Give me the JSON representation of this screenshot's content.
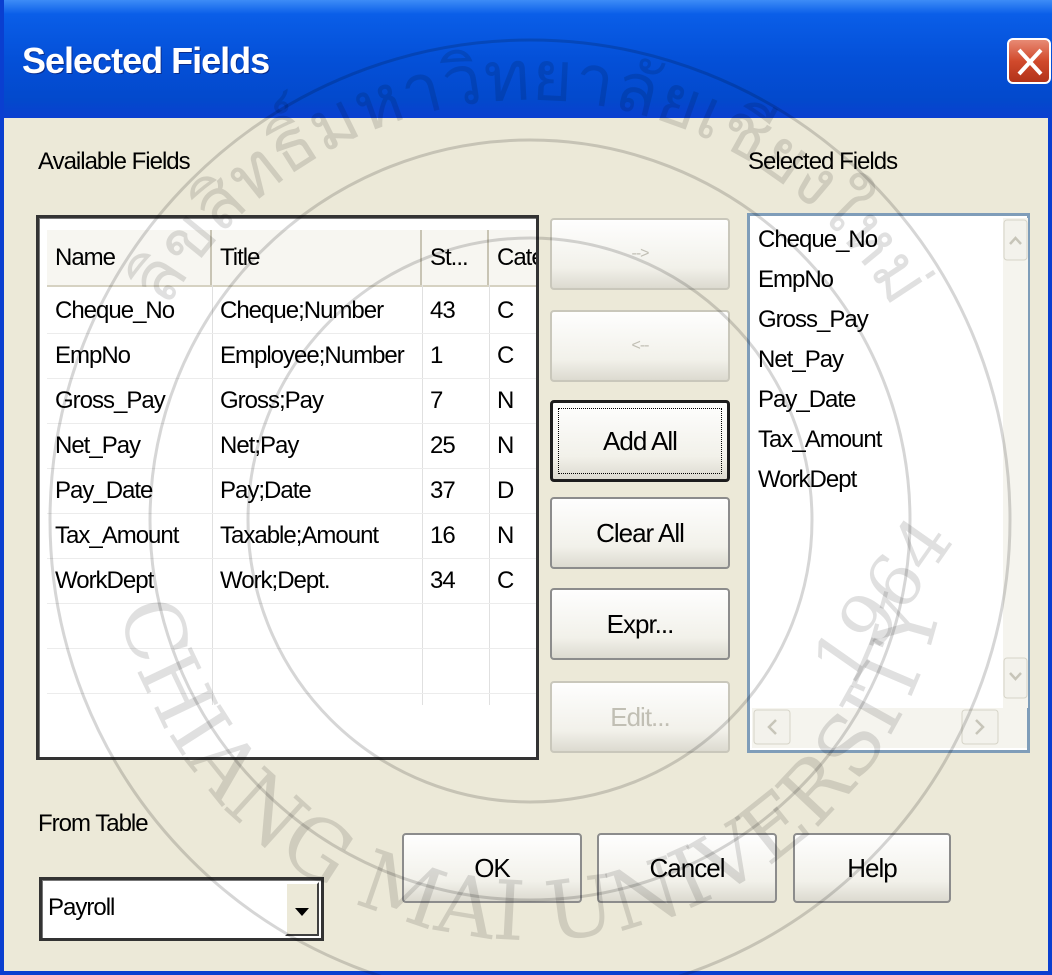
{
  "window": {
    "title": "Selected Fields"
  },
  "available": {
    "label": "Available Fields",
    "columns": [
      "Name",
      "Title",
      "St...",
      "Cate"
    ],
    "rows": [
      [
        "Cheque_No",
        "Cheque;Number",
        "43",
        "C"
      ],
      [
        "EmpNo",
        "Employee;Number",
        "1",
        "C"
      ],
      [
        "Gross_Pay",
        "Gross;Pay",
        "7",
        "N"
      ],
      [
        "Net_Pay",
        "Net;Pay",
        "25",
        "N"
      ],
      [
        "Pay_Date",
        "Pay;Date",
        "37",
        "D"
      ],
      [
        "Tax_Amount",
        "Taxable;Amount",
        "16",
        "N"
      ],
      [
        "WorkDept",
        "Work;Dept.",
        "34",
        "C"
      ]
    ]
  },
  "buttons": {
    "add": "-->",
    "remove": "<--",
    "add_all": "Add All",
    "clear_all": "Clear All",
    "expr": "Expr...",
    "edit": "Edit...",
    "ok": "OK",
    "cancel": "Cancel",
    "help": "Help"
  },
  "selected": {
    "label": "Selected Fields",
    "items": [
      "Cheque_No",
      "EmpNo",
      "Gross_Pay",
      "Net_Pay",
      "Pay_Date",
      "Tax_Amount",
      "WorkDept"
    ]
  },
  "from_table": {
    "label": "From Table",
    "value": "Payroll"
  },
  "watermark": {
    "thai_text": "ลิขสิทธิ์มหาวิทยาลัยเชียงใหม่",
    "english_text": "CHIANG MAI UNIVERSITY",
    "year": "1964"
  },
  "colors": {
    "titlebar": "#0450d8",
    "face": "#ece9d8",
    "close": "#d14a2c"
  }
}
